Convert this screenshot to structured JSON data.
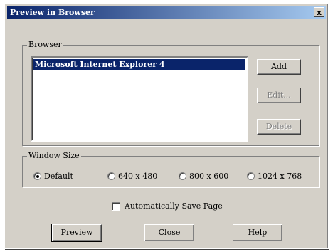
{
  "window": {
    "title": "Preview in Browser",
    "close_glyph": "x"
  },
  "browser_group": {
    "label": "Browser",
    "items": [
      {
        "label": "Microsoft Internet Explorer 4",
        "selected": true
      }
    ],
    "buttons": {
      "add": "Add",
      "edit": "Edit...",
      "delete": "Delete"
    }
  },
  "window_size_group": {
    "label": "Window Size",
    "options": [
      {
        "label": "Default",
        "checked": true
      },
      {
        "label": "640 x 480",
        "checked": false
      },
      {
        "label": "800 x 600",
        "checked": false
      },
      {
        "label": "1024 x 768",
        "checked": false
      }
    ]
  },
  "auto_save": {
    "label": "Automatically Save Page",
    "checked": false
  },
  "footer": {
    "preview": "Preview",
    "close": "Close",
    "help": "Help"
  },
  "colors": {
    "titlebar_start": "#0a246a",
    "titlebar_end": "#a6caf0",
    "face": "#d4d0c8"
  }
}
